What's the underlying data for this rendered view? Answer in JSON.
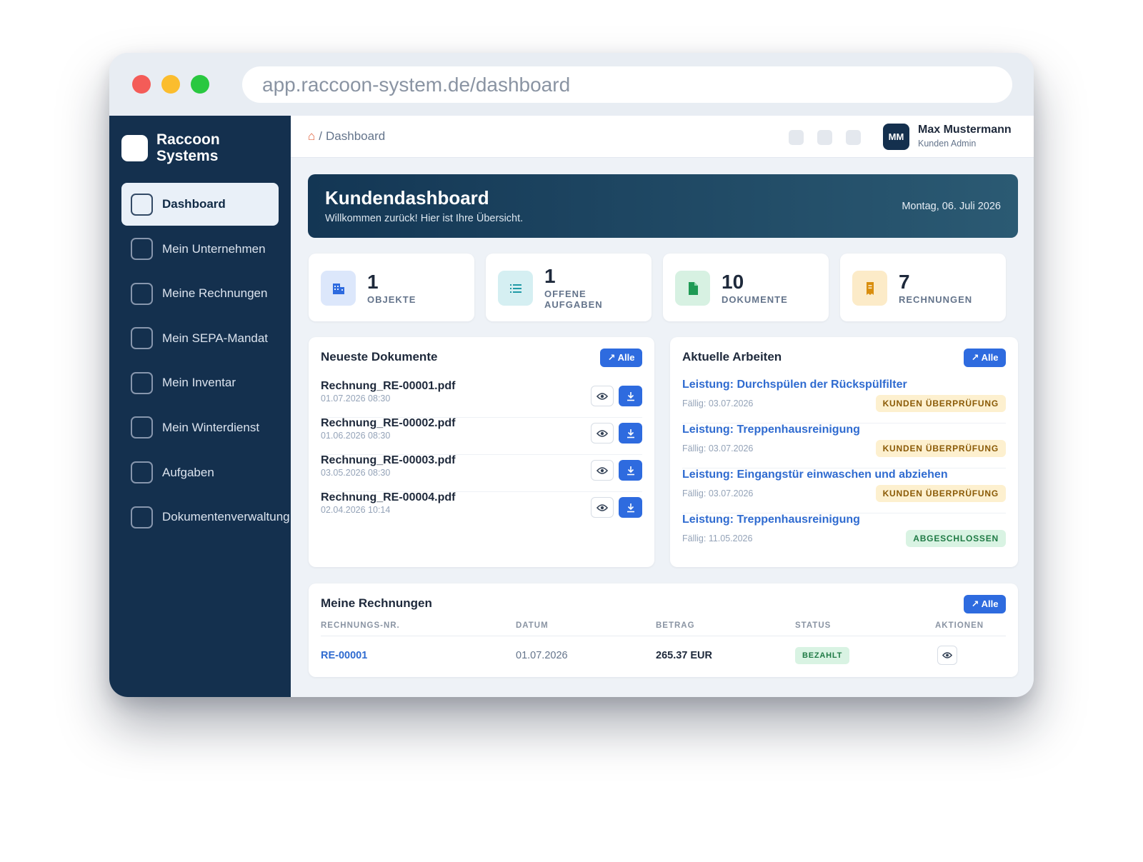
{
  "browser": {
    "url": "app.raccoon-system.de/dashboard"
  },
  "brand": {
    "name": "Raccoon Systems"
  },
  "sidebar": {
    "items": [
      {
        "label": "Dashboard",
        "active": true
      },
      {
        "label": "Mein Unternehmen"
      },
      {
        "label": "Meine Rechnungen"
      },
      {
        "label": "Mein SEPA-Mandat"
      },
      {
        "label": "Mein Inventar"
      },
      {
        "label": "Mein Winterdienst"
      },
      {
        "label": "Aufgaben"
      },
      {
        "label": "Dokumentenverwaltung"
      }
    ]
  },
  "topbar": {
    "breadcrumb_sep": "/",
    "breadcrumb_page": "Dashboard",
    "user": {
      "initials": "MM",
      "name": "Max Mustermann",
      "role": "Kunden Admin"
    }
  },
  "hero": {
    "title": "Kundendashboard",
    "subtitle": "Willkommen zurück! Hier ist Ihre Übersicht.",
    "date": "Montag, 06. Juli 2026"
  },
  "stats": [
    {
      "value": "1",
      "label": "OBJEKTE",
      "icon": "building-icon",
      "color": "#2e6bdf",
      "bg": "#dce7fb"
    },
    {
      "value": "1",
      "label": "OFFENE AUFGABEN",
      "icon": "list-icon",
      "color": "#1f9aa6",
      "bg": "#d5eff2"
    },
    {
      "value": "10",
      "label": "DOKUMENTE",
      "icon": "document-icon",
      "color": "#1f9a55",
      "bg": "#d7f1e2"
    },
    {
      "value": "7",
      "label": "RECHNUNGEN",
      "icon": "receipt-icon",
      "color": "#d98e0e",
      "bg": "#fcebc8"
    }
  ],
  "documents": {
    "title": "Neueste Dokumente",
    "all_label": "↗ Alle",
    "items": [
      {
        "name": "Rechnung_RE-00001.pdf",
        "date": "01.07.2026 08:30"
      },
      {
        "name": "Rechnung_RE-00002.pdf",
        "date": "01.06.2026 08:30"
      },
      {
        "name": "Rechnung_RE-00003.pdf",
        "date": "03.05.2026 08:30"
      },
      {
        "name": "Rechnung_RE-00004.pdf",
        "date": "02.04.2026 10:14"
      }
    ]
  },
  "work": {
    "title": "Aktuelle Arbeiten",
    "all_label": "↗ Alle",
    "items": [
      {
        "title": "Leistung: Durchspülen der Rückspülfilter",
        "due": "Fällig: 03.07.2026",
        "status": "KUNDEN ÜBERPRÜFUNG",
        "status_type": "warn"
      },
      {
        "title": "Leistung: Treppenhausreinigung",
        "due": "Fällig: 03.07.2026",
        "status": "KUNDEN ÜBERPRÜFUNG",
        "status_type": "warn"
      },
      {
        "title": "Leistung: Eingangstür einwaschen und abziehen",
        "due": "Fällig: 03.07.2026",
        "status": "KUNDEN ÜBERPRÜFUNG",
        "status_type": "warn"
      },
      {
        "title": "Leistung: Treppenhausreinigung",
        "due": "Fällig: 11.05.2026",
        "status": "ABGESCHLOSSEN",
        "status_type": "done"
      }
    ]
  },
  "invoices": {
    "title": "Meine Rechnungen",
    "all_label": "↗ Alle",
    "columns": [
      "RECHNUNGS-NR.",
      "DATUM",
      "BETRAG",
      "STATUS",
      "AKTIONEN"
    ],
    "rows": [
      {
        "number": "RE-00001",
        "date": "01.07.2026",
        "amount": "265.37 EUR",
        "status": "BEZAHLT"
      }
    ]
  }
}
